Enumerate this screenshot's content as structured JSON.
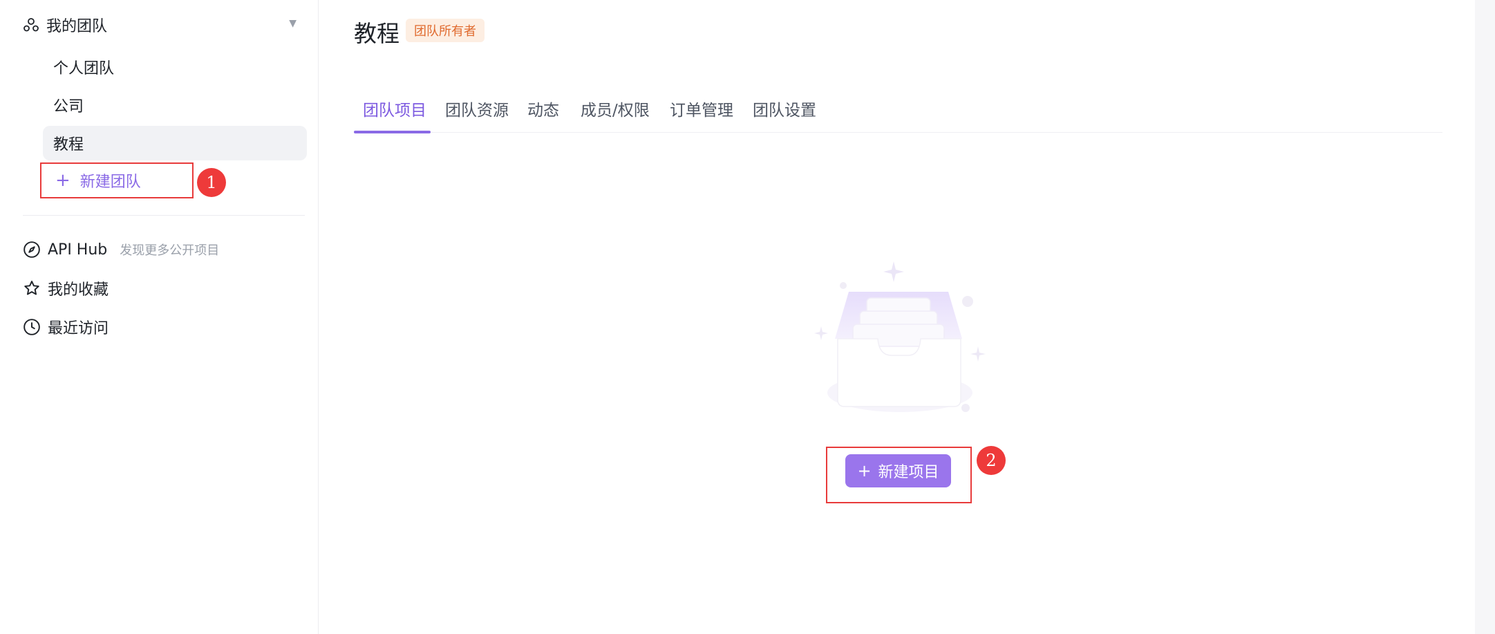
{
  "sidebar": {
    "team_header": {
      "label": "我的团队",
      "caret": "▼",
      "icon": "team-icon"
    },
    "teams": [
      {
        "label": "个人团队",
        "active": false
      },
      {
        "label": "公司",
        "active": false
      },
      {
        "label": "教程",
        "active": true
      }
    ],
    "new_team": {
      "plus": "+",
      "label": "新建团队"
    },
    "nav": [
      {
        "label": "API Hub",
        "sub": "发现更多公开项目",
        "icon": "compass-icon"
      },
      {
        "label": "我的收藏",
        "sub": "",
        "icon": "star-icon"
      },
      {
        "label": "最近访问",
        "sub": "",
        "icon": "clock-icon"
      }
    ]
  },
  "annotations": {
    "one": "1",
    "two": "2",
    "color": "#ee3a3a"
  },
  "main": {
    "title": "教程",
    "owner_badge": "团队所有者",
    "tabs": [
      {
        "label": "团队项目",
        "active": true
      },
      {
        "label": "团队资源",
        "active": false
      },
      {
        "label": "动态",
        "active": false
      },
      {
        "label": "成员/权限",
        "active": false
      },
      {
        "label": "订单管理",
        "active": false
      },
      {
        "label": "团队设置",
        "active": false
      }
    ],
    "empty_state": {
      "illustration": "empty-box-illustration"
    },
    "new_project": {
      "plus": "+",
      "label": "新建项目"
    }
  },
  "colors": {
    "accent": "#8a6ae6",
    "button": "#9a75ec",
    "badge_bg": "#fdeee2",
    "badge_text": "#e06a2e",
    "highlight_frame": "#e83b3b"
  }
}
